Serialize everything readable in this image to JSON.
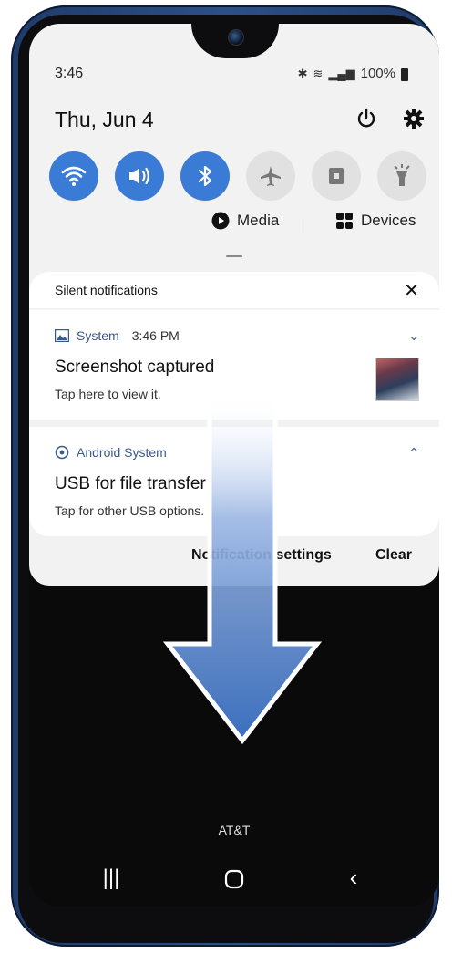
{
  "status_bar": {
    "time": "3:46",
    "battery": "100%"
  },
  "date": "Thu, Jun 4",
  "quick_tiles": [
    {
      "icon": "wifi-icon",
      "active": true
    },
    {
      "icon": "sound-icon",
      "active": true
    },
    {
      "icon": "bluetooth-icon",
      "active": true
    },
    {
      "icon": "airplane-icon",
      "active": false
    },
    {
      "icon": "lock-icon",
      "active": false
    },
    {
      "icon": "flashlight-icon",
      "active": false
    }
  ],
  "media_label": "Media",
  "devices_label": "Devices",
  "silent_notifications": "Silent notifications",
  "notifications": [
    {
      "app": "System",
      "time": "3:46 PM",
      "title": "Screenshot captured",
      "subtitle": "Tap here to view it."
    },
    {
      "app": "Android System",
      "title": "USB for file transfer",
      "subtitle": "Tap for other USB options."
    }
  ],
  "footer": {
    "settings_label": "Notification settings",
    "clear_label": "Clear"
  },
  "carrier": "AT&T",
  "colors": {
    "accent": "#3a7bd5",
    "arrow": "#3b6fbf"
  }
}
